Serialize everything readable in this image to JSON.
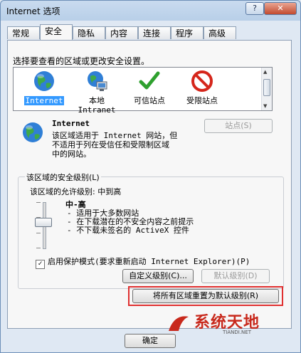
{
  "window": {
    "title": "Internet 选项",
    "help_glyph": "?",
    "close_glyph": "✕"
  },
  "tabs": [
    {
      "label": "常规"
    },
    {
      "label": "安全"
    },
    {
      "label": "隐私"
    },
    {
      "label": "内容"
    },
    {
      "label": "连接"
    },
    {
      "label": "程序"
    },
    {
      "label": "高级"
    }
  ],
  "active_tab": "安全",
  "zone_prompt": "选择要查看的区域或更改安全设置。",
  "zones": [
    {
      "label": "Internet",
      "icon": "globe-icon",
      "selected": true
    },
    {
      "label": "本地\nIntranet",
      "icon": "intranet-icon",
      "selected": false
    },
    {
      "label": "可信站点",
      "icon": "checkmark-icon",
      "selected": false
    },
    {
      "label": "受限站点",
      "icon": "prohibited-icon",
      "selected": false
    }
  ],
  "zone_info": {
    "title": "Internet",
    "desc_lines": [
      "该区域适用于 Internet 网站，但",
      "不适用于列在受信任和受限制区域",
      "中的网站。"
    ],
    "sites_button": "站点(S)"
  },
  "security_group": {
    "legend": "该区域的安全级别(L)",
    "allowed": "该区域的允许级别: 中到高",
    "level_name": "中-高",
    "level_desc": [
      "适用于大多数网站",
      "在下载潜在的不安全内容之前提示",
      "不下载未签名的 ActiveX 控件"
    ],
    "slider_level_fraction": 0.5,
    "protected_mode": "启用保护模式(要求重新启动 Internet Explorer)(P)",
    "protected_checked": true,
    "custom_button": "自定义级别(C)...",
    "default_button": "默认级别(D)"
  },
  "reset_button": "将所有区域重置为默认级别(R)",
  "footer": {
    "ok_button": "确定"
  },
  "watermark": {
    "main": "系统天地",
    "sub": "TIANDI.NET"
  },
  "colors": {
    "selection": "#3399ff",
    "highlight_box": "#e03030",
    "brand": "#c8291c"
  }
}
